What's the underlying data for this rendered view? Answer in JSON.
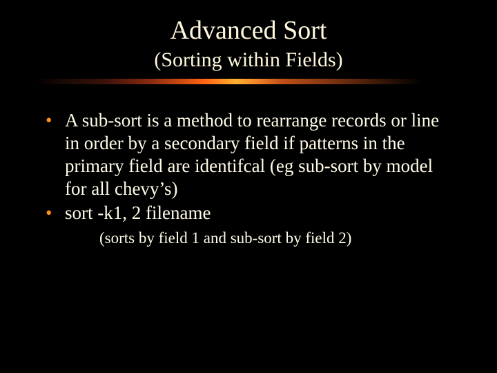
{
  "title": "Advanced Sort",
  "subtitle": "(Sorting within Fields)",
  "bullets": [
    "A sub-sort is a method to rearrange records or line in order by a secondary field if patterns in the primary field are identifcal (eg sub-sort by model for all chevy’s)",
    "sort -k1, 2 filename"
  ],
  "subnote": "(sorts by field 1 and sub-sort by field 2)"
}
